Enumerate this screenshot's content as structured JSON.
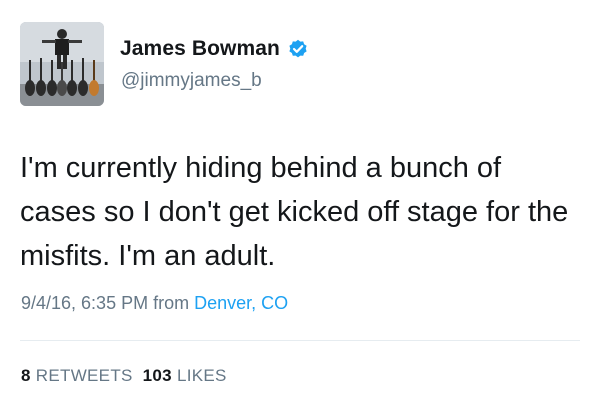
{
  "author": {
    "name": "James Bowman",
    "handle": "@jimmyjames_b"
  },
  "tweet": {
    "text": "I'm currently hiding behind a bunch of cases so I don't get kicked off stage for the misfits. I'm an adult.",
    "timestamp": "9/4/16, 6:35 PM",
    "from_label": "from",
    "location": "Denver, CO"
  },
  "stats": {
    "retweets_count": "8",
    "retweets_label": "RETWEETS",
    "likes_count": "103",
    "likes_label": "LIKES"
  },
  "colors": {
    "accent": "#1da1f2",
    "secondary_text": "#657786",
    "primary_text": "#14171a"
  },
  "icons": {
    "verified": "verified-badge-icon"
  }
}
